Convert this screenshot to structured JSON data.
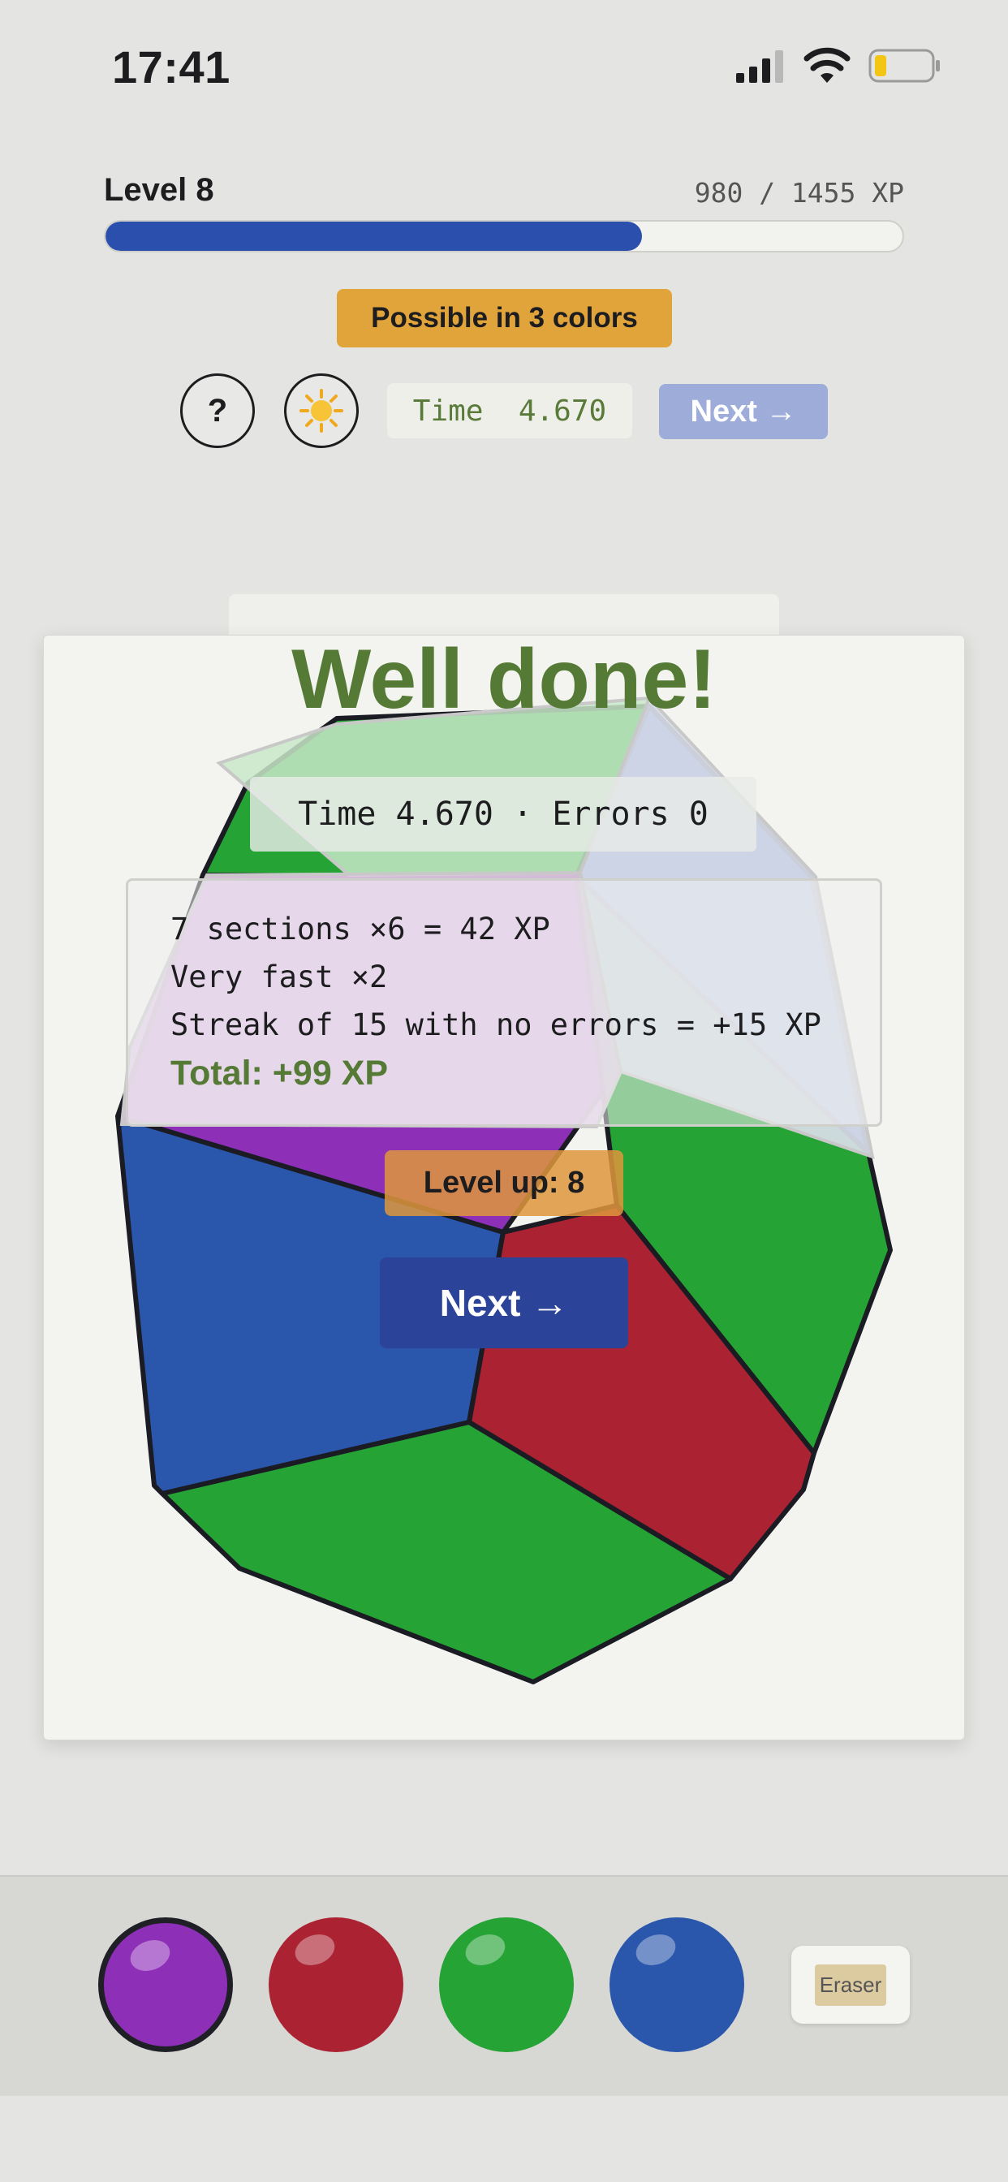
{
  "status": {
    "time": "17:41"
  },
  "level": {
    "label": "Level 8",
    "xp_text": "980 / 1455 XP",
    "progress": 0.673
  },
  "hint_badge": "Possible in 3 colors",
  "toolbar": {
    "help_label": "?",
    "theme_icon": "sun-icon",
    "timer_text": "Time  4.670",
    "next_label": "Next →"
  },
  "result": {
    "title": "Well done!",
    "stats": "Time 4.670 · Errors 0",
    "breakdown": [
      "7 sections ×6 = 42 XP",
      "Very fast ×2",
      "Streak of 15 with no errors = +15 XP"
    ],
    "total": "Total: +99 XP",
    "level_up": "Level up: 8",
    "next_label": "Next →"
  },
  "palette": {
    "colors": [
      "#8e2fb8",
      "#ab2332",
      "#26a335",
      "#2a57ac"
    ],
    "selected": 0,
    "eraser_label": "Eraser"
  },
  "colors": {
    "accent_blue": "#2b4fad",
    "success_green": "#557a36",
    "badge_orange": "#e0a43a"
  }
}
